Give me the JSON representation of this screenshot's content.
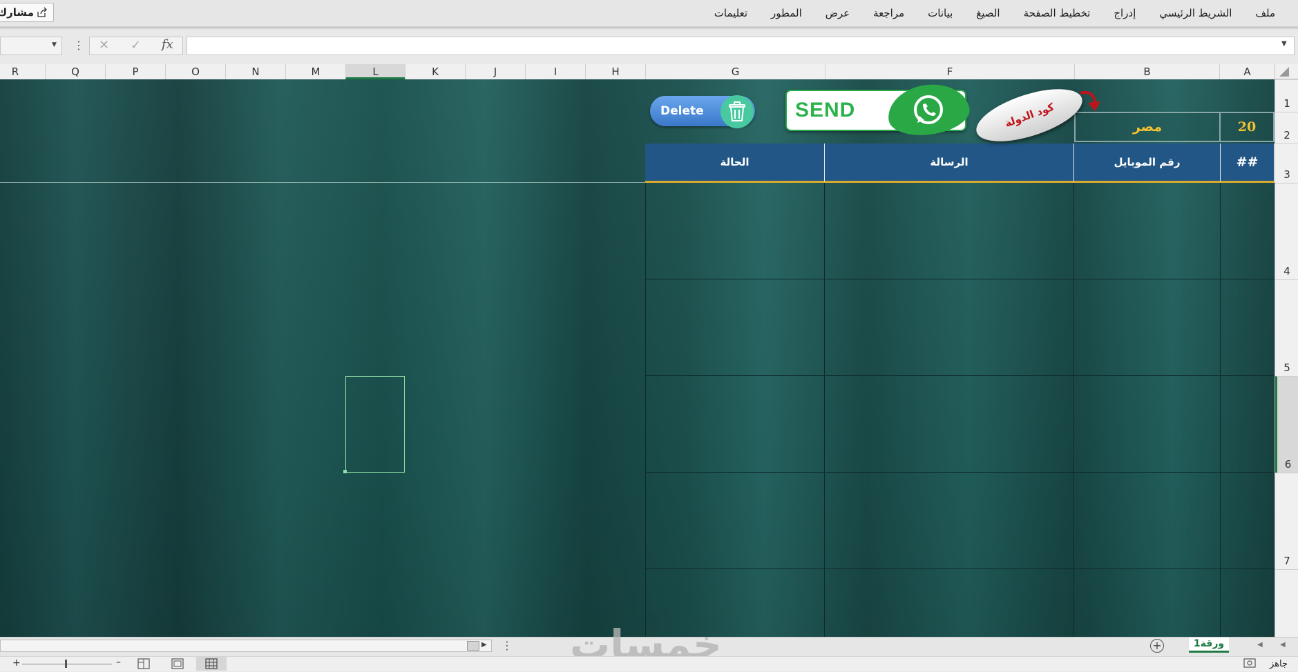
{
  "ribbon": {
    "tabs": [
      "ملف",
      "الشريط الرئيسي",
      "إدراج",
      "تخطيط الصفحة",
      "الصيغ",
      "بيانات",
      "مراجعة",
      "عرض",
      "المطور",
      "تعليمات"
    ],
    "share_label": "مشارك"
  },
  "columns": [
    "A",
    "B",
    "F",
    "G",
    "H",
    "I",
    "J",
    "K",
    "L",
    "M",
    "N",
    "O",
    "P",
    "Q",
    "R"
  ],
  "selected_column": "L",
  "rows": [
    "1",
    "2",
    "3",
    "4",
    "5",
    "6",
    "7"
  ],
  "selected_row": "6",
  "sheet": {
    "country_code": "20",
    "country_name": "مصر",
    "headers": {
      "index": "##",
      "mobile": "رقم الموبايل",
      "message": "الرسالة",
      "status": "الحالة"
    },
    "delete_label": "Delete",
    "send_label": "SEND",
    "country_code_badge": "كود الدولة"
  },
  "sheet_tabs": [
    "ورقة1"
  ],
  "status": {
    "ready": "جاهز"
  },
  "watermark": "خمسات",
  "colors": {
    "header_blue": "#215687",
    "accent_gold": "#d9a92a",
    "whatsapp_green": "#2aa845",
    "excel_green": "#1e7a44"
  }
}
